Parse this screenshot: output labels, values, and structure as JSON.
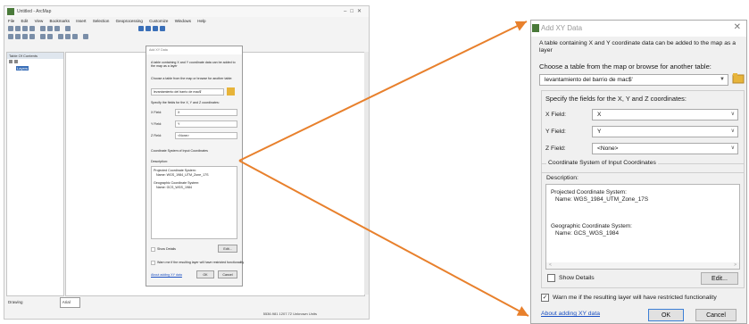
{
  "arcmap": {
    "window_title": "Untitled - ArcMap",
    "menus": [
      "File",
      "Edit",
      "View",
      "Bookmarks",
      "Insert",
      "Selection",
      "Geoprocessing",
      "Customize",
      "Windows",
      "Help"
    ],
    "toc_title": "Table Of Contents",
    "layers_label": "Layers",
    "drawing_label": "Drawing",
    "font_name": "Arial",
    "status_coords": "5536.981 1207.72 Unknown Units"
  },
  "mini_dialog": {
    "title": "Add XY Data",
    "intro": "A table containing X and Y coordinate data can be added to the map as a layer",
    "choose_label": "Choose a table from the map or browse for another table:",
    "table_value": "levantamiento del barrio de mac$'",
    "fields_label": "Specify the fields for the X, Y and Z coordinates:",
    "x_label": "X Field:",
    "x_value": "X",
    "y_label": "Y Field:",
    "y_value": "Y",
    "z_label": "Z Field:",
    "z_value": "<None>",
    "coord_label": "Coordinate System of Input Coordinates",
    "desc_label": "Description:",
    "projected": "Projected Coordinate System:",
    "projected_name": "Name: WGS_1984_UTM_Zone_17S",
    "geographic": "Geographic Coordinate System:",
    "geographic_name": "Name: GCS_WGS_1984",
    "show_details": "Show Details",
    "edit": "Edit...",
    "warn": "Warn me if the resulting layer will have restricted functionality",
    "about": "About adding XY data",
    "ok": "OK",
    "cancel": "Cancel"
  },
  "dialog": {
    "title": "Add XY Data",
    "close_glyph": "✕",
    "intro": "A table containing X and Y coordinate data can be added to the map as a layer",
    "choose_label": "Choose a table from the map or browse for another table:",
    "table_value": "levantamiento del barrio de mac$'",
    "fields_label": "Specify the fields for the X, Y and Z coordinates:",
    "x_label": "X Field:",
    "x_value": "X",
    "y_label": "Y Field:",
    "y_value": "Y",
    "z_label": "Z Field:",
    "z_value": "<None>",
    "coord_group_label": "Coordinate System of Input Coordinates",
    "desc_label": "Description:",
    "projected": "Projected Coordinate System:",
    "projected_name": "Name: WGS_1984_UTM_Zone_17S",
    "geographic": "Geographic Coordinate System:",
    "geographic_name": "Name: GCS_WGS_1984",
    "show_details": "Show Details",
    "edit": "Edit...",
    "warn": "Warn me if the resulting layer will have restricted functionality",
    "warn_checked": true,
    "about": "About adding XY data",
    "ok": "OK",
    "cancel": "Cancel"
  },
  "colors": {
    "arrow": "#e8802c",
    "link": "#1a4fc2",
    "folder_icon": "#e7b43a"
  }
}
